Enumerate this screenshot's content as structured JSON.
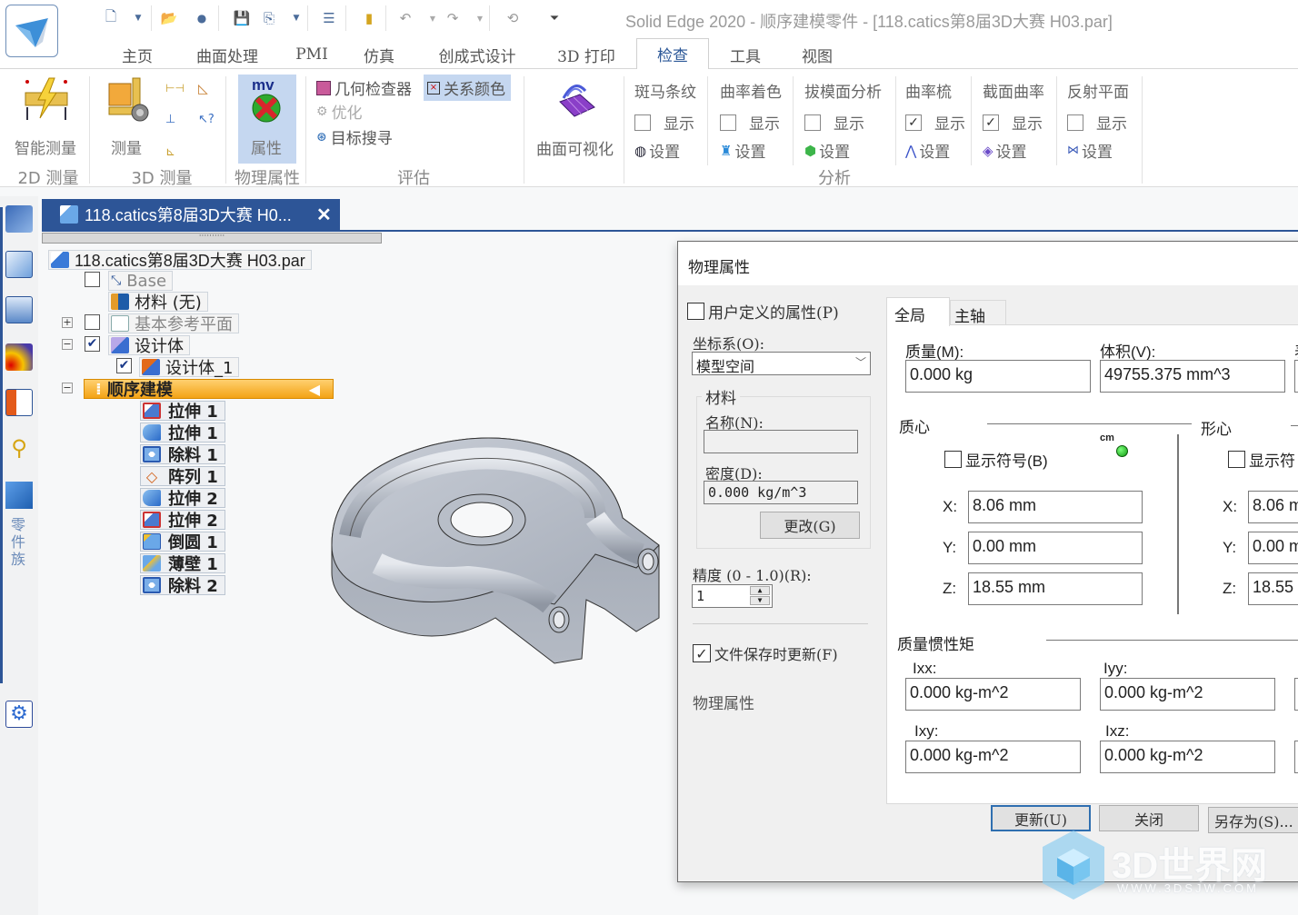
{
  "window": {
    "title": "Solid Edge 2020 - 顺序建模零件 - [118.catics第8届3D大赛 H03.par]"
  },
  "quick_access": [
    "new-document-icon",
    "dropdown-icon",
    "open-icon",
    "link-icon",
    "save-icon",
    "save-all-icon",
    "dropdown-icon",
    "properties-list-icon",
    "exit-icon",
    "undo-icon",
    "dropdown-icon",
    "redo-icon",
    "dropdown-icon",
    "repeat-icon",
    "customize-icon"
  ],
  "ribbon_tabs": [
    {
      "label": "主页",
      "active": false
    },
    {
      "label": "曲面处理",
      "active": false
    },
    {
      "label": "PMI",
      "active": false
    },
    {
      "label": "仿真",
      "active": false
    },
    {
      "label": "创成式设计",
      "active": false
    },
    {
      "label": "3D 打印",
      "active": false
    },
    {
      "label": "检查",
      "active": true
    },
    {
      "label": "工具",
      "active": false
    },
    {
      "label": "视图",
      "active": false
    }
  ],
  "ribbon": {
    "groups": {
      "measure2d": {
        "label": "2D 测量",
        "smart_measure": "智能测量"
      },
      "measure3d": {
        "label": "3D 测量",
        "measure": "测量"
      },
      "physprops": {
        "label": "物理属性",
        "properties": "属性"
      },
      "evaluate": {
        "label": "评估",
        "geometry_inspector": "几何检查器",
        "relation_colors": "关系颜色",
        "optimize": "优化",
        "goal_seek": "目标搜寻"
      },
      "surface_vis": {
        "label": "曲面可视化"
      },
      "analysis": {
        "label": "分析"
      }
    },
    "analysis_items": [
      {
        "title": "斑马条纹",
        "show": "显示",
        "checked": false,
        "settings": "设置",
        "icon": "zebra-stripes-icon"
      },
      {
        "title": "曲率着色",
        "show": "显示",
        "checked": false,
        "settings": "设置",
        "icon": "curvature-shading-icon"
      },
      {
        "title": "拔模面分析",
        "show": "显示",
        "checked": false,
        "settings": "设置",
        "icon": "draft-face-icon"
      },
      {
        "title": "曲率梳",
        "show": "显示",
        "checked": true,
        "settings": "设置",
        "icon": "curvature-comb-icon"
      },
      {
        "title": "截面曲率",
        "show": "显示",
        "checked": true,
        "settings": "设置",
        "icon": "section-curvature-icon"
      },
      {
        "title": "反射平面",
        "show": "显示",
        "checked": false,
        "settings": "设置",
        "icon": "reflective-plane-icon"
      }
    ]
  },
  "doc_tab": {
    "label": "118.catics第8届3D大赛 H0...",
    "close": "✕"
  },
  "tree": {
    "root": "118.catics第8届3D大赛 H03.par",
    "base": "Base",
    "material": "材料 (无)",
    "ref_planes": "基本参考平面",
    "design_body": "设计体",
    "design_body_1": "设计体_1",
    "ordered": "顺序建模",
    "features": [
      {
        "label": "拉伸 1",
        "icon": "extrude-icon"
      },
      {
        "label": "拉伸 1",
        "icon": "sweep-icon"
      },
      {
        "label": "除料 1",
        "icon": "cutout-icon"
      },
      {
        "label": "阵列 1",
        "icon": "pattern-icon"
      },
      {
        "label": "拉伸 2",
        "icon": "sweep-icon"
      },
      {
        "label": "拉伸 2",
        "icon": "extrude-icon"
      },
      {
        "label": "倒圆 1",
        "icon": "round-icon"
      },
      {
        "label": "薄壁 1",
        "icon": "thinwall-icon"
      },
      {
        "label": "除料 2",
        "icon": "cutout-icon"
      }
    ]
  },
  "left_strip": {
    "part_family_label": "零件族"
  },
  "dialog": {
    "title": "物理属性",
    "user_defined": "用户定义的属性(P)",
    "user_defined_checked": false,
    "coord_label": "坐标系(O):",
    "coord_value": "模型空间",
    "material_group": "材料",
    "name_label": "名称(N):",
    "name_value": "",
    "density_label": "密度(D):",
    "density_value": "0.000 kg/m^3",
    "change_button": "更改(G)",
    "accuracy_label": "精度 (0 - 1.0)(R):",
    "accuracy_value": "1",
    "update_on_save": "文件保存时更新(F)",
    "update_on_save_checked": true,
    "footer_label": "物理属性",
    "tabs": [
      {
        "label": "全局",
        "active": true
      },
      {
        "label": "主轴",
        "active": false
      }
    ],
    "mass_label": "质量(M):",
    "mass_value": "0.000 kg",
    "volume_label": "体积(V):",
    "volume_value": "49755.375 mm^3",
    "third_label_partial": "表",
    "com_label": "质心",
    "com_show": "显示符号(B)",
    "com_symbol": "cm",
    "com": {
      "x": "8.06 mm",
      "y": "0.00 mm",
      "z": "18.55 mm"
    },
    "centroid_label": "形心",
    "centroid_show": "显示符",
    "centroid": {
      "x": "8.06 m",
      "y": "0.00 m",
      "z": "18.55"
    },
    "axis_labels": {
      "x": "X:",
      "y": "Y:",
      "z": "Z:"
    },
    "inertia_label": "质量惯性矩",
    "ixx_label": "Ixx:",
    "ixx": "0.000 kg-m^2",
    "iyy_label": "Iyy:",
    "iyy": "0.000 kg-m^2",
    "ixy_label": "Ixy:",
    "ixy": "0.000 kg-m^2",
    "ixz_label": "Ixz:",
    "ixz": "0.000 kg-m^2",
    "update_button": "更新(U)",
    "close_button": "关闭",
    "saveas_button": "另存为(S)..."
  },
  "watermark": {
    "text": "3D世界网",
    "url_text": "WWW.3DSJW.COM"
  }
}
